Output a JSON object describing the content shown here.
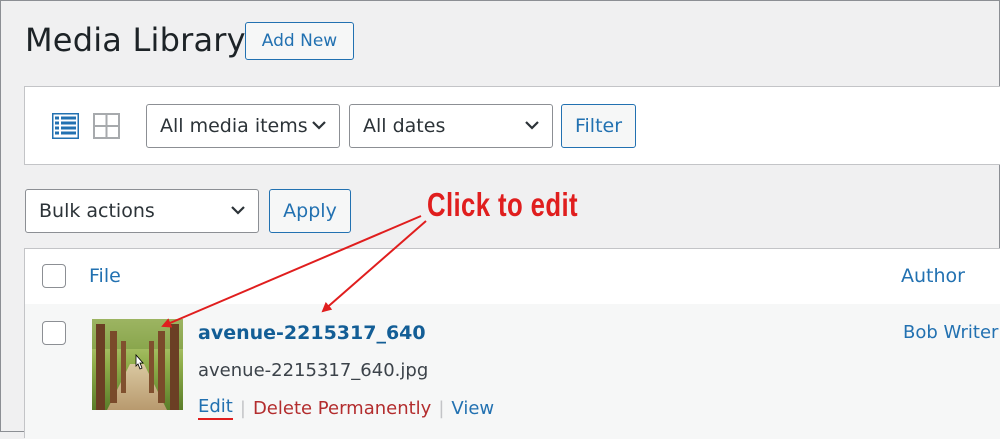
{
  "header": {
    "title": "Media Library",
    "add_new_label": "Add New"
  },
  "filter_bar": {
    "view_modes": [
      "list-view-icon",
      "grid-view-icon"
    ],
    "media_type_selected": "All media items",
    "dates_selected": "All dates",
    "filter_label": "Filter"
  },
  "bulk": {
    "selected": "Bulk actions",
    "apply_label": "Apply"
  },
  "annotation": {
    "text": "Click to edit"
  },
  "table": {
    "columns": [
      "File",
      "Author"
    ],
    "rows": [
      {
        "title": "avenue-2215317_640",
        "filename": "avenue-2215317_640.jpg",
        "actions": [
          "Edit",
          "Delete Permanently",
          "View"
        ],
        "author": "Bob Writer"
      }
    ]
  },
  "colors": {
    "accent": "#2271b1",
    "annotation": "#e01e1e",
    "delete": "#b32d2e"
  }
}
